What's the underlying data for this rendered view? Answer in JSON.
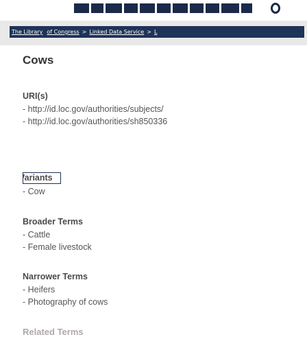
{
  "navbar": {
    "breadcrumbs": [
      "The Library",
      "of Congress",
      "Linked Data Service",
      "L"
    ],
    "separator": ">"
  },
  "page": {
    "title": "Cows"
  },
  "uris": {
    "heading": "URI(s)",
    "items": [
      "- http://id.loc.gov/authorities/subjects/",
      "- http://id.loc.gov/authorities/sh850336"
    ]
  },
  "variants": {
    "heading": "Variants",
    "items": [
      "- Cow"
    ]
  },
  "broader_terms": {
    "heading": "Broader Terms",
    "items": [
      "- Cattle",
      "- Female livestock"
    ]
  },
  "narrower_terms": {
    "heading": "Narrower Terms",
    "items": [
      "- Heifers",
      "- Photography of cows"
    ]
  },
  "related_terms": {
    "heading": "Related Terms"
  },
  "colors": {
    "navy": "#1f3258",
    "banner": "#1b2a4a"
  }
}
